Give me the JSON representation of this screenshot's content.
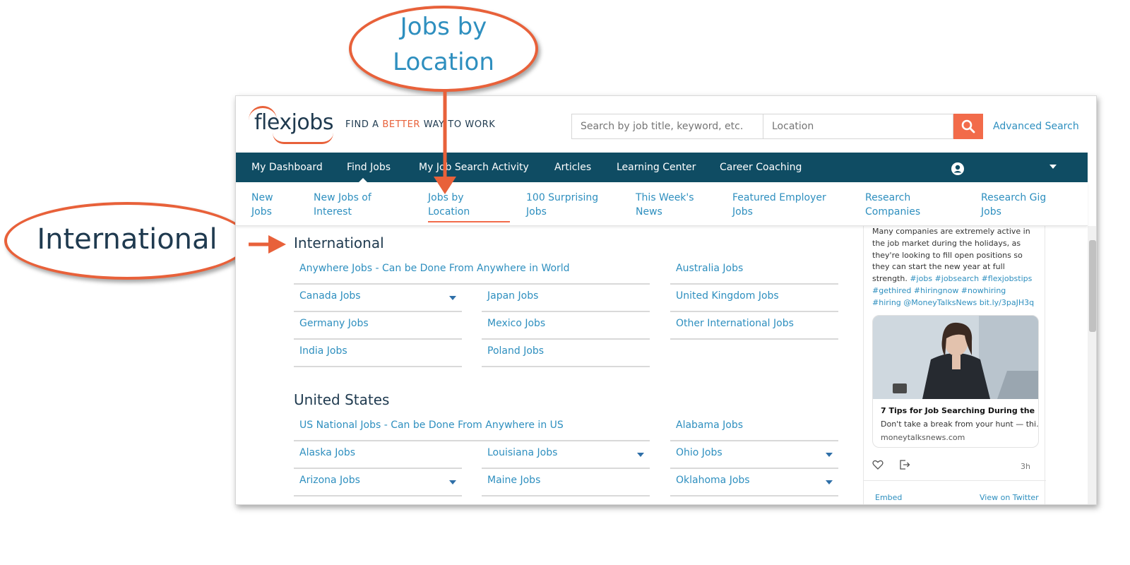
{
  "annotations": {
    "callout_top_line1": "Jobs by",
    "callout_top_line2": "Location",
    "callout_left": "International",
    "accent_color": "#e8613a"
  },
  "header": {
    "logo": "flexjobs",
    "tagline_pre": "FIND A ",
    "tagline_accent": "BETTER",
    "tagline_post": " WAY TO WORK",
    "search_placeholder": "Search by job title, keyword, etc.",
    "location_placeholder": "Location",
    "search_icon": "search-icon",
    "advanced_search": "Advanced Search"
  },
  "nav": {
    "items": [
      "My Dashboard",
      "Find Jobs",
      "My Job Search Activity",
      "Articles",
      "Learning Center",
      "Career Coaching"
    ],
    "active": "Find Jobs",
    "user_icon": "user-icon",
    "dropdown_icon": "caret-down-icon"
  },
  "subnav": {
    "items": [
      {
        "line1": "New",
        "line2": "Jobs"
      },
      {
        "line1": "New Jobs of",
        "line2": "Interest"
      },
      {
        "line1": "Jobs by",
        "line2": "Location"
      },
      {
        "line1": "100 Surprising",
        "line2": "Jobs"
      },
      {
        "line1": "This Week's",
        "line2": "News"
      },
      {
        "line1": "Featured Employer",
        "line2": "Jobs"
      },
      {
        "line1": "Research",
        "line2": "Companies"
      },
      {
        "line1": "Research Gig",
        "line2": "Jobs"
      }
    ],
    "active_index": 2
  },
  "sections": {
    "international": {
      "title": "International",
      "wide": "Anywhere Jobs - Can be Done From Anywhere in World",
      "links": [
        "Australia Jobs",
        "Canada Jobs",
        "Japan Jobs",
        "United Kingdom Jobs",
        "Germany Jobs",
        "Mexico Jobs",
        "Other International Jobs",
        "India Jobs",
        "Poland Jobs"
      ]
    },
    "united_states": {
      "title": "United States",
      "wide": "US National Jobs - Can be Done From Anywhere in US",
      "links": [
        "Alabama Jobs",
        "Alaska Jobs",
        "Louisiana Jobs",
        "Ohio Jobs",
        "Arizona Jobs",
        "Maine Jobs",
        "Oklahoma Jobs"
      ]
    }
  },
  "sidebar": {
    "tweet_text": "Many companies are extremely active in the job market during the holidays, as they're looking to fill open positions so they can start the new year at full strength.",
    "tweet_tags": "#jobs #jobsearch #flexjobstips #gethired #hiringnow #nowhiring #hiring @MoneyTalksNews bit.ly/3paJH3q",
    "card_title": "7 Tips for Job Searching During the ...",
    "card_desc": "Don't take a break from your hunt — thi...",
    "card_source": "moneytalksnews.com",
    "time": "3h",
    "embed": "Embed",
    "view_on_twitter": "View on Twitter"
  },
  "colors": {
    "navy": "#0f4c63",
    "link_blue": "#2e8fbf",
    "orange": "#f26b4a",
    "heading": "#1f3a4f"
  }
}
